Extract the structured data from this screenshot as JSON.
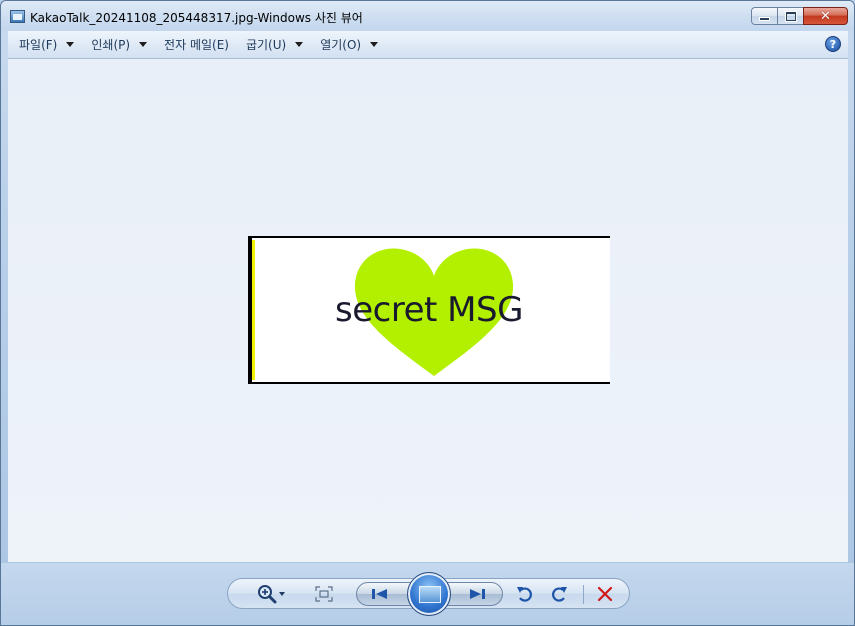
{
  "window": {
    "title": "KakaoTalk_20241108_205448317.jpg-Windows 사진 뷰어",
    "app_icon": "photo-viewer-icon"
  },
  "caption_buttons": {
    "minimize": "minimize-icon",
    "maximize": "maximize-icon",
    "close": "✕"
  },
  "menu": {
    "items": [
      {
        "label": "파일(F)"
      },
      {
        "label": "인쇄(P)"
      },
      {
        "label": "전자 메일(E)"
      },
      {
        "label": "굽기(U)"
      },
      {
        "label": "열기(O)"
      }
    ],
    "help_glyph": "?"
  },
  "photo": {
    "text": "secret MSG",
    "heart_color": "#b3f000",
    "background": "#ffffff"
  },
  "controls": {
    "icons": [
      "zoom-icon",
      "fit-to-window-icon",
      "previous-icon",
      "slideshow-icon",
      "next-icon",
      "rotate-counterclockwise-icon",
      "rotate-clockwise-icon",
      "delete-icon"
    ],
    "accent": "#2f74cf",
    "delete_color": "#d01818"
  }
}
